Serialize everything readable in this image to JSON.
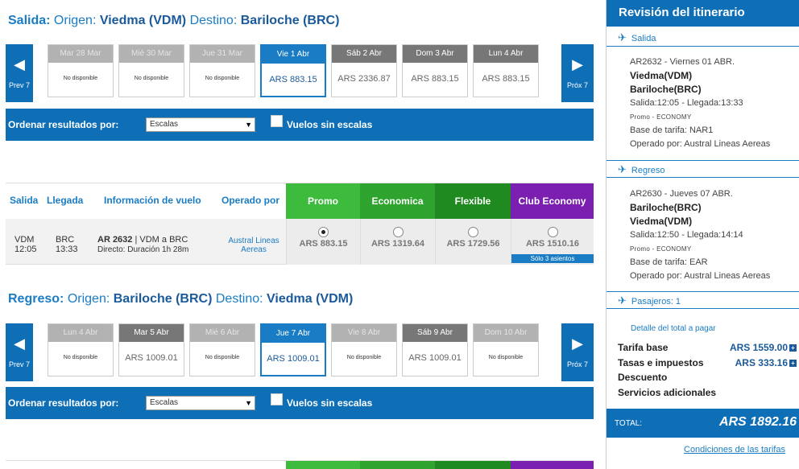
{
  "outbound": {
    "label": "Salida:",
    "origin_label": "Origen:",
    "origin": "Viedma (VDM)",
    "dest_label": "Destino:",
    "dest": "Bariloche (BRC)",
    "prev": "Prev 7",
    "next": "Próx 7",
    "days": [
      {
        "label": "Mar 28 Mar",
        "price": "No disponible",
        "state": "disabled"
      },
      {
        "label": "Mié 30 Mar",
        "price": "No disponible",
        "state": "disabled"
      },
      {
        "label": "Jue 31 Mar",
        "price": "No disponible",
        "state": "disabled"
      },
      {
        "label": "Vie 1 Abr",
        "price": "ARS 883.15",
        "state": "selected"
      },
      {
        "label": "Sáb 2 Abr",
        "price": "ARS 2336.87",
        "state": "normal"
      },
      {
        "label": "Dom 3 Abr",
        "price": "ARS 883.15",
        "state": "normal"
      },
      {
        "label": "Lun 4 Abr",
        "price": "ARS 883.15",
        "state": "normal"
      }
    ]
  },
  "sort": {
    "label": "Ordenar resultados por:",
    "selected": "Escalas",
    "nonstop_label": "Vuelos sin escalas"
  },
  "table": {
    "headers": [
      "Salida",
      "Llegada",
      "Información de vuelo",
      "Operado por"
    ],
    "fares": [
      {
        "name": "Promo",
        "color": "#3dbb3d"
      },
      {
        "name": "Economica",
        "color": "#2ea32e"
      },
      {
        "name": "Flexible",
        "color": "#1f8a1f"
      },
      {
        "name": "Club Economy",
        "color": "#7a1fb0"
      }
    ],
    "row": {
      "dep_code": "VDM",
      "dep_time": "12:05",
      "arr_code": "BRC",
      "arr_time": "13:33",
      "flight": "AR 2632",
      "route": "| VDM a BRC",
      "duration": "Directo: Duración 1h 28m",
      "operator": "Austral Lineas Aereas",
      "prices": [
        "ARS 883.15",
        "ARS 1319.64",
        "ARS 1729.56",
        "ARS 1510.16"
      ],
      "selected_index": 0,
      "seats_note": "Sólo 3 asientos"
    }
  },
  "inbound": {
    "label": "Regreso:",
    "origin_label": "Origen:",
    "origin": "Bariloche (BRC)",
    "dest_label": "Destino:",
    "dest": "Viedma (VDM)",
    "prev": "Prev 7",
    "next": "Próx 7",
    "days": [
      {
        "label": "Lun 4 Abr",
        "price": "No disponible",
        "state": "disabled"
      },
      {
        "label": "Mar 5 Abr",
        "price": "ARS 1009.01",
        "state": "normal"
      },
      {
        "label": "Mié 6 Abr",
        "price": "No disponible",
        "state": "disabled"
      },
      {
        "label": "Jue 7 Abr",
        "price": "ARS 1009.01",
        "state": "selected"
      },
      {
        "label": "Vie 8 Abr",
        "price": "No disponible",
        "state": "disabled"
      },
      {
        "label": "Sáb 9 Abr",
        "price": "ARS 1009.01",
        "state": "normal"
      },
      {
        "label": "Dom 10 Abr",
        "price": "No disponible",
        "state": "disabled"
      }
    ]
  },
  "sidebar": {
    "title": "Revisión del itinerario",
    "outbound_head": "Salida",
    "outbound": {
      "line1": "AR2632 - Viernes 01 ABR.",
      "from": "Viedma(VDM)",
      "to": "Bariloche(BRC)",
      "times": "Salida:12:05 - Llegada:13:33",
      "cabin": "Promo - ECONOMY",
      "fare_base": "Base de tarifa: NAR1",
      "operator": "Operado por: Austral Lineas Aereas"
    },
    "inbound_head": "Regreso",
    "inbound": {
      "line1": "AR2630 - Jueves 07 ABR.",
      "from": "Bariloche(BRC)",
      "to": "Viedma(VDM)",
      "times": "Salida:12:50 - Llegada:14:14",
      "cabin": "Promo - ECONOMY",
      "fare_base": "Base de tarifa: EAR",
      "operator": "Operado por: Austral Lineas Aereas"
    },
    "passengers": "Pasajeros: 1",
    "detail_link": "Detalle del total a pagar",
    "tarifa_label": "Tarifa base",
    "tarifa_value": "ARS 1559.00",
    "tasas_label": "Tasas e impuestos",
    "tasas_value": "ARS 333.16",
    "descuento_label": "Descuento",
    "servicios_label": "Servicios adicionales",
    "total_label": "TOTAL:",
    "total_value": "ARS 1892.16",
    "conditions": "Condiciones de las tarifas"
  }
}
